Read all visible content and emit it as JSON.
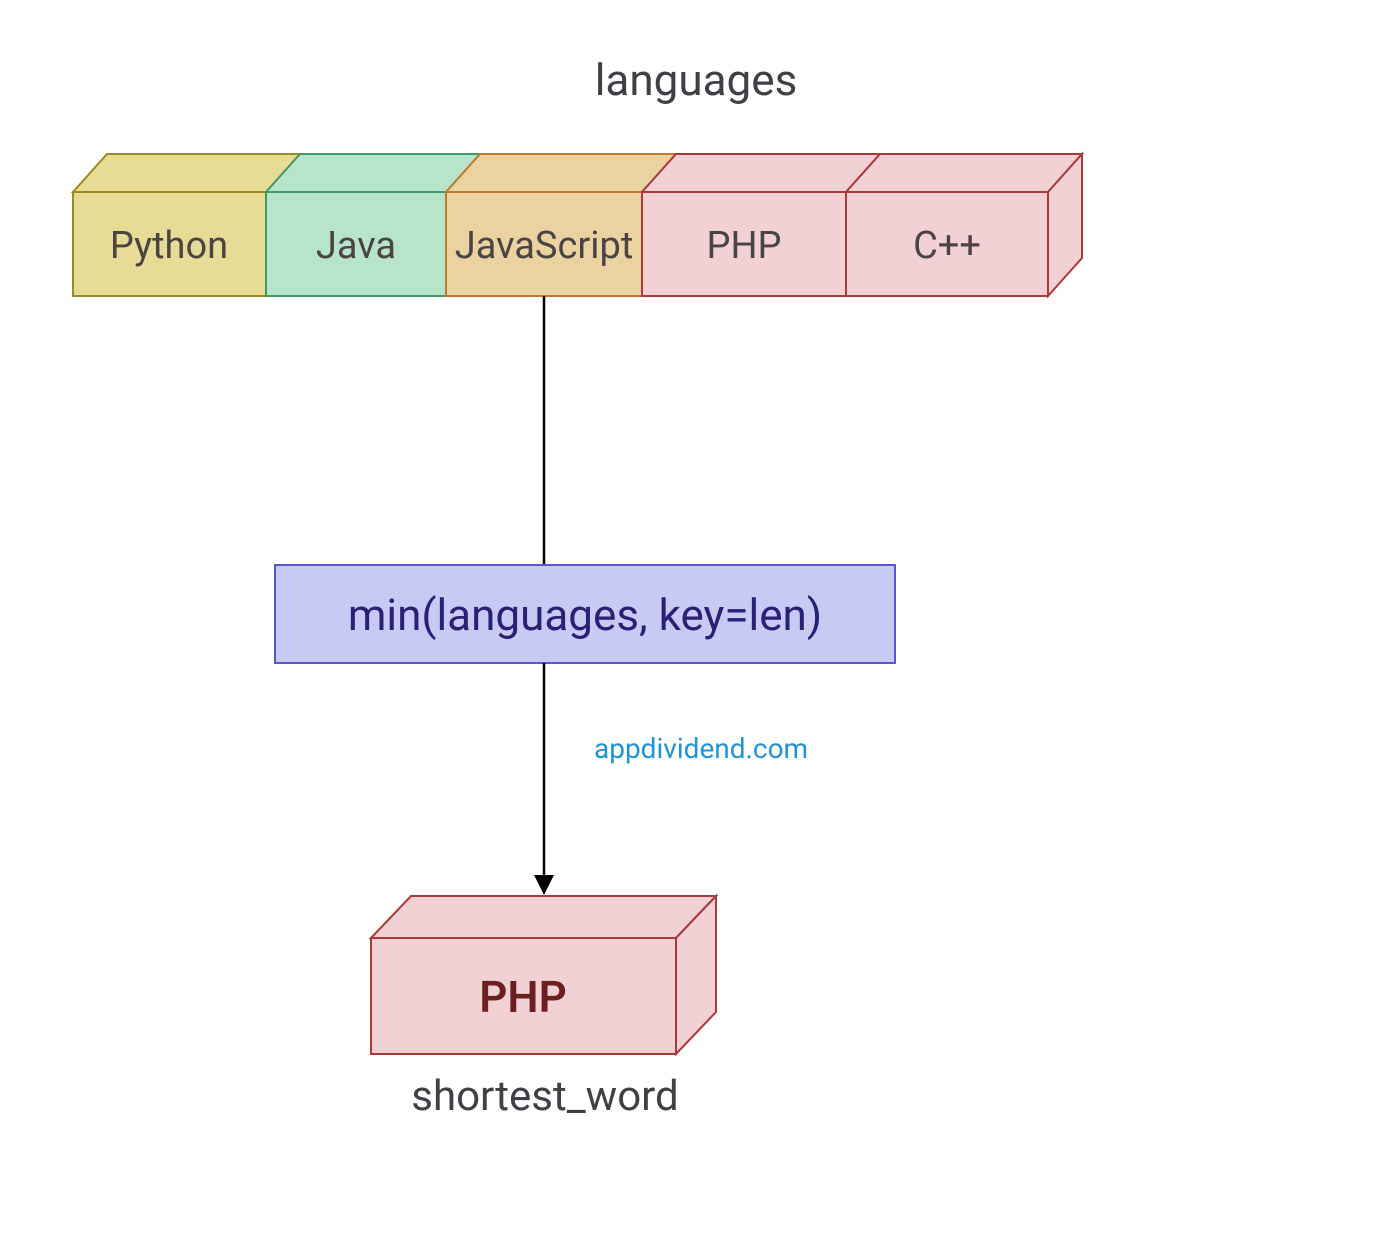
{
  "title": "languages",
  "cells": [
    {
      "label": "Python",
      "fill": "#e7dc95",
      "stroke": "#9a8a20"
    },
    {
      "label": "Java",
      "fill": "#b9e4cc",
      "stroke": "#3f9a68"
    },
    {
      "label": "JavaScript",
      "fill": "#ead2a1",
      "stroke": "#bf7a2d"
    },
    {
      "label": "PHP",
      "fill": "#f1d1d4",
      "stroke": "#a83a3c"
    },
    {
      "label": "C++",
      "fill": "#f1d1d4",
      "stroke": "#a83a3c"
    }
  ],
  "function_box": {
    "label": "min(languages, key=len)",
    "fill": "#c7caf2",
    "stroke": "#5a58c6"
  },
  "watermark": "appdividend.com",
  "result_box": {
    "label": "PHP",
    "fill": "#f1d1d4",
    "stroke": "#a83a3c"
  },
  "bottom_label": "shortest_word"
}
